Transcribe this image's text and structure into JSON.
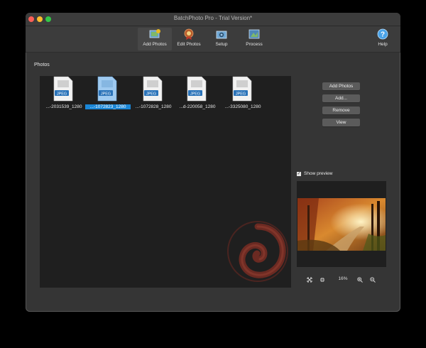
{
  "window": {
    "title": "BatchPhoto Pro - Trial Version*"
  },
  "toolbar": {
    "add_photos": "Add Photos",
    "edit_photos": "Edit Photos",
    "setup": "Setup",
    "process": "Process",
    "help": "Help"
  },
  "photos": {
    "section_label": "Photos",
    "items": [
      {
        "label": "...-2031539_1280",
        "type": "JPEG"
      },
      {
        "label": "...-1072823_1280",
        "type": "JPEG"
      },
      {
        "label": "...-1072828_1280",
        "type": "JPEG"
      },
      {
        "label": "...d-220058_1280",
        "type": "JPEG"
      },
      {
        "label": "...-3325080_1280",
        "type": "JPEG"
      }
    ]
  },
  "buttons": {
    "add_photos": "Add Photos",
    "add": "Add...",
    "remove": "Remove",
    "view": "View"
  },
  "preview": {
    "show_preview_label": "Show preview",
    "show_preview_checked": true,
    "zoom": "16%"
  },
  "colors": {
    "selection": "#1a86d6",
    "background": "#353535",
    "panel": "#1f1f1f"
  }
}
